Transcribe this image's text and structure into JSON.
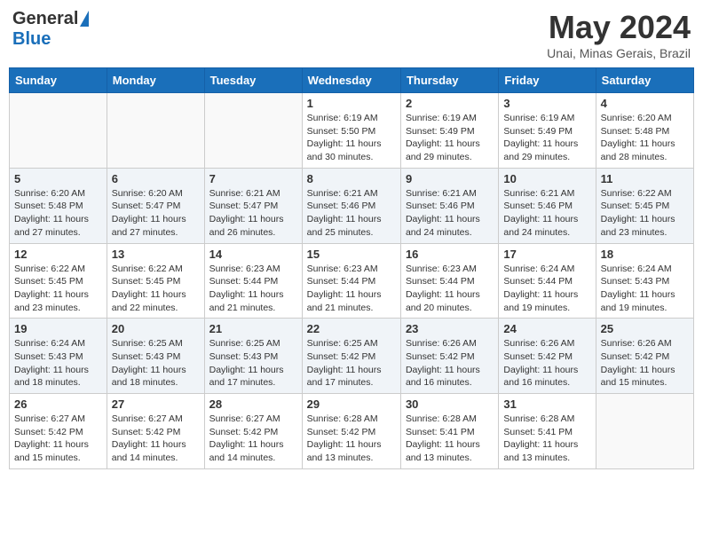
{
  "header": {
    "logo_general": "General",
    "logo_blue": "Blue",
    "month_title": "May 2024",
    "location": "Unai, Minas Gerais, Brazil"
  },
  "weekdays": [
    "Sunday",
    "Monday",
    "Tuesday",
    "Wednesday",
    "Thursday",
    "Friday",
    "Saturday"
  ],
  "weeks": [
    [
      {
        "day": "",
        "sunrise": "",
        "sunset": "",
        "daylight": ""
      },
      {
        "day": "",
        "sunrise": "",
        "sunset": "",
        "daylight": ""
      },
      {
        "day": "",
        "sunrise": "",
        "sunset": "",
        "daylight": ""
      },
      {
        "day": "1",
        "sunrise": "Sunrise: 6:19 AM",
        "sunset": "Sunset: 5:50 PM",
        "daylight": "Daylight: 11 hours and 30 minutes."
      },
      {
        "day": "2",
        "sunrise": "Sunrise: 6:19 AM",
        "sunset": "Sunset: 5:49 PM",
        "daylight": "Daylight: 11 hours and 29 minutes."
      },
      {
        "day": "3",
        "sunrise": "Sunrise: 6:19 AM",
        "sunset": "Sunset: 5:49 PM",
        "daylight": "Daylight: 11 hours and 29 minutes."
      },
      {
        "day": "4",
        "sunrise": "Sunrise: 6:20 AM",
        "sunset": "Sunset: 5:48 PM",
        "daylight": "Daylight: 11 hours and 28 minutes."
      }
    ],
    [
      {
        "day": "5",
        "sunrise": "Sunrise: 6:20 AM",
        "sunset": "Sunset: 5:48 PM",
        "daylight": "Daylight: 11 hours and 27 minutes."
      },
      {
        "day": "6",
        "sunrise": "Sunrise: 6:20 AM",
        "sunset": "Sunset: 5:47 PM",
        "daylight": "Daylight: 11 hours and 27 minutes."
      },
      {
        "day": "7",
        "sunrise": "Sunrise: 6:21 AM",
        "sunset": "Sunset: 5:47 PM",
        "daylight": "Daylight: 11 hours and 26 minutes."
      },
      {
        "day": "8",
        "sunrise": "Sunrise: 6:21 AM",
        "sunset": "Sunset: 5:46 PM",
        "daylight": "Daylight: 11 hours and 25 minutes."
      },
      {
        "day": "9",
        "sunrise": "Sunrise: 6:21 AM",
        "sunset": "Sunset: 5:46 PM",
        "daylight": "Daylight: 11 hours and 24 minutes."
      },
      {
        "day": "10",
        "sunrise": "Sunrise: 6:21 AM",
        "sunset": "Sunset: 5:46 PM",
        "daylight": "Daylight: 11 hours and 24 minutes."
      },
      {
        "day": "11",
        "sunrise": "Sunrise: 6:22 AM",
        "sunset": "Sunset: 5:45 PM",
        "daylight": "Daylight: 11 hours and 23 minutes."
      }
    ],
    [
      {
        "day": "12",
        "sunrise": "Sunrise: 6:22 AM",
        "sunset": "Sunset: 5:45 PM",
        "daylight": "Daylight: 11 hours and 23 minutes."
      },
      {
        "day": "13",
        "sunrise": "Sunrise: 6:22 AM",
        "sunset": "Sunset: 5:45 PM",
        "daylight": "Daylight: 11 hours and 22 minutes."
      },
      {
        "day": "14",
        "sunrise": "Sunrise: 6:23 AM",
        "sunset": "Sunset: 5:44 PM",
        "daylight": "Daylight: 11 hours and 21 minutes."
      },
      {
        "day": "15",
        "sunrise": "Sunrise: 6:23 AM",
        "sunset": "Sunset: 5:44 PM",
        "daylight": "Daylight: 11 hours and 21 minutes."
      },
      {
        "day": "16",
        "sunrise": "Sunrise: 6:23 AM",
        "sunset": "Sunset: 5:44 PM",
        "daylight": "Daylight: 11 hours and 20 minutes."
      },
      {
        "day": "17",
        "sunrise": "Sunrise: 6:24 AM",
        "sunset": "Sunset: 5:44 PM",
        "daylight": "Daylight: 11 hours and 19 minutes."
      },
      {
        "day": "18",
        "sunrise": "Sunrise: 6:24 AM",
        "sunset": "Sunset: 5:43 PM",
        "daylight": "Daylight: 11 hours and 19 minutes."
      }
    ],
    [
      {
        "day": "19",
        "sunrise": "Sunrise: 6:24 AM",
        "sunset": "Sunset: 5:43 PM",
        "daylight": "Daylight: 11 hours and 18 minutes."
      },
      {
        "day": "20",
        "sunrise": "Sunrise: 6:25 AM",
        "sunset": "Sunset: 5:43 PM",
        "daylight": "Daylight: 11 hours and 18 minutes."
      },
      {
        "day": "21",
        "sunrise": "Sunrise: 6:25 AM",
        "sunset": "Sunset: 5:43 PM",
        "daylight": "Daylight: 11 hours and 17 minutes."
      },
      {
        "day": "22",
        "sunrise": "Sunrise: 6:25 AM",
        "sunset": "Sunset: 5:42 PM",
        "daylight": "Daylight: 11 hours and 17 minutes."
      },
      {
        "day": "23",
        "sunrise": "Sunrise: 6:26 AM",
        "sunset": "Sunset: 5:42 PM",
        "daylight": "Daylight: 11 hours and 16 minutes."
      },
      {
        "day": "24",
        "sunrise": "Sunrise: 6:26 AM",
        "sunset": "Sunset: 5:42 PM",
        "daylight": "Daylight: 11 hours and 16 minutes."
      },
      {
        "day": "25",
        "sunrise": "Sunrise: 6:26 AM",
        "sunset": "Sunset: 5:42 PM",
        "daylight": "Daylight: 11 hours and 15 minutes."
      }
    ],
    [
      {
        "day": "26",
        "sunrise": "Sunrise: 6:27 AM",
        "sunset": "Sunset: 5:42 PM",
        "daylight": "Daylight: 11 hours and 15 minutes."
      },
      {
        "day": "27",
        "sunrise": "Sunrise: 6:27 AM",
        "sunset": "Sunset: 5:42 PM",
        "daylight": "Daylight: 11 hours and 14 minutes."
      },
      {
        "day": "28",
        "sunrise": "Sunrise: 6:27 AM",
        "sunset": "Sunset: 5:42 PM",
        "daylight": "Daylight: 11 hours and 14 minutes."
      },
      {
        "day": "29",
        "sunrise": "Sunrise: 6:28 AM",
        "sunset": "Sunset: 5:42 PM",
        "daylight": "Daylight: 11 hours and 13 minutes."
      },
      {
        "day": "30",
        "sunrise": "Sunrise: 6:28 AM",
        "sunset": "Sunset: 5:41 PM",
        "daylight": "Daylight: 11 hours and 13 minutes."
      },
      {
        "day": "31",
        "sunrise": "Sunrise: 6:28 AM",
        "sunset": "Sunset: 5:41 PM",
        "daylight": "Daylight: 11 hours and 13 minutes."
      },
      {
        "day": "",
        "sunrise": "",
        "sunset": "",
        "daylight": ""
      }
    ]
  ]
}
